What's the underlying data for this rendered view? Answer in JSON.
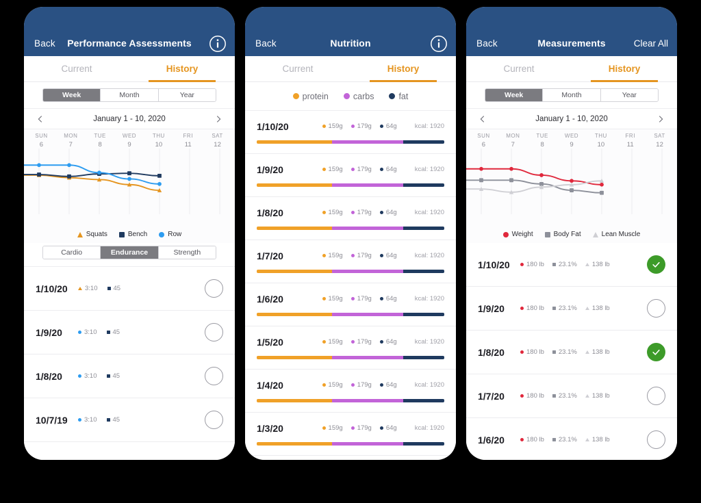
{
  "theme": {
    "nav_bg": "#2a5183",
    "accent_orange": "#e59520",
    "segment_active": "#7b7b80",
    "check_green": "#3d9b29",
    "page_bg": "#000000"
  },
  "shared": {
    "back_label": "Back",
    "tab_current": "Current",
    "tab_history": "History",
    "seg_week": "Week",
    "seg_month": "Month",
    "seg_year": "Year",
    "date_range": "January 1 - 10, 2020",
    "prev_icon": "chevron-left-icon",
    "next_icon": "chevron-right-icon",
    "days": [
      {
        "name": "SUN",
        "num": "6"
      },
      {
        "name": "MON",
        "num": "7"
      },
      {
        "name": "TUE",
        "num": "8"
      },
      {
        "name": "WED",
        "num": "9"
      },
      {
        "name": "THU",
        "num": "10"
      },
      {
        "name": "FRI",
        "num": "11"
      },
      {
        "name": "SAT",
        "num": "12"
      }
    ]
  },
  "panel1": {
    "title": "Performance Assessments",
    "info_icon": "info-circle-icon",
    "chart_data": {
      "type": "line",
      "title": "Performance Assessments",
      "x": [
        "6",
        "7",
        "8",
        "9",
        "10"
      ],
      "xlabel": "",
      "ylabel": "",
      "grid": true,
      "legend_position": "bottom",
      "series": [
        {
          "name": "Squats",
          "color": "#e59520",
          "marker": "triangle",
          "values": [
            62,
            58,
            55,
            47,
            38
          ]
        },
        {
          "name": "Bench",
          "color": "#1f3a5f",
          "marker": "square",
          "values": [
            63,
            60,
            64,
            65,
            61
          ]
        },
        {
          "name": "Row",
          "color": "#2d9cf0",
          "marker": "circle",
          "values": [
            78,
            78,
            66,
            56,
            48
          ]
        }
      ]
    },
    "legend": [
      {
        "label": "Squats",
        "marker": "triangle",
        "color": "#e59520"
      },
      {
        "label": "Bench",
        "marker": "square",
        "color": "#1f3a5f"
      },
      {
        "label": "Row",
        "marker": "circle",
        "color": "#2d9cf0"
      }
    ],
    "filter": {
      "cardio": "Cardio",
      "endurance": "Endurance",
      "strength": "Strength",
      "active": "Endurance"
    },
    "rows": [
      {
        "date": "1/10/20",
        "m1": "3:10",
        "m1_marker": "triangle",
        "m1_color": "#e59520",
        "m2": "45",
        "m2_marker": "square",
        "m2_color": "#1f3a5f",
        "checked": false
      },
      {
        "date": "1/9/20",
        "m1": "3:10",
        "m1_marker": "circle",
        "m1_color": "#2d9cf0",
        "m2": "45",
        "m2_marker": "square",
        "m2_color": "#1f3a5f",
        "checked": false
      },
      {
        "date": "1/8/20",
        "m1": "3:10",
        "m1_marker": "circle",
        "m1_color": "#2d9cf0",
        "m2": "45",
        "m2_marker": "square",
        "m2_color": "#1f3a5f",
        "checked": false
      },
      {
        "date": "10/7/19",
        "m1": "3:10",
        "m1_marker": "circle",
        "m1_color": "#2d9cf0",
        "m2": "45",
        "m2_marker": "square",
        "m2_color": "#1f3a5f",
        "checked": false
      }
    ]
  },
  "panel2": {
    "title": "Nutrition",
    "info_icon": "info-circle-icon",
    "legend": [
      {
        "label": "protein",
        "color": "#f0a128"
      },
      {
        "label": "carbs",
        "color": "#c264d8"
      },
      {
        "label": "fat",
        "color": "#1f3a5f"
      }
    ],
    "chart_data": {
      "type": "bar",
      "title": "Nutrition macros per day",
      "categories": [
        "1/10/20",
        "1/9/20",
        "1/8/20",
        "1/7/20",
        "1/6/20",
        "1/5/20",
        "1/4/20",
        "1/3/20"
      ],
      "series": [
        {
          "name": "protein",
          "color": "#f0a128",
          "unit": "g",
          "values": [
            159,
            159,
            159,
            159,
            159,
            159,
            159,
            159
          ]
        },
        {
          "name": "carbs",
          "color": "#c264d8",
          "unit": "g",
          "values": [
            179,
            179,
            179,
            179,
            179,
            179,
            179,
            179
          ]
        },
        {
          "name": "fat",
          "color": "#1f3a5f",
          "unit": "g",
          "values": [
            64,
            64,
            64,
            64,
            64,
            64,
            64,
            64
          ]
        }
      ],
      "kcal": [
        1920,
        1920,
        1920,
        1920,
        1920,
        1920,
        1920,
        1920
      ],
      "stacked": true
    },
    "rows": [
      {
        "date": "1/10/20",
        "protein": "159g",
        "carbs": "179g",
        "fat": "64g",
        "kcal": "kcal: 1920",
        "p_pct": 40,
        "c_pct": 38,
        "f_pct": 22
      },
      {
        "date": "1/9/20",
        "protein": "159g",
        "carbs": "179g",
        "fat": "64g",
        "kcal": "kcal: 1920",
        "p_pct": 40,
        "c_pct": 38,
        "f_pct": 22
      },
      {
        "date": "1/8/20",
        "protein": "159g",
        "carbs": "179g",
        "fat": "64g",
        "kcal": "kcal: 1920",
        "p_pct": 40,
        "c_pct": 38,
        "f_pct": 22
      },
      {
        "date": "1/7/20",
        "protein": "159g",
        "carbs": "179g",
        "fat": "64g",
        "kcal": "kcal: 1920",
        "p_pct": 40,
        "c_pct": 38,
        "f_pct": 22
      },
      {
        "date": "1/6/20",
        "protein": "159g",
        "carbs": "179g",
        "fat": "64g",
        "kcal": "kcal: 1920",
        "p_pct": 40,
        "c_pct": 38,
        "f_pct": 22
      },
      {
        "date": "1/5/20",
        "protein": "159g",
        "carbs": "179g",
        "fat": "64g",
        "kcal": "kcal: 1920",
        "p_pct": 40,
        "c_pct": 38,
        "f_pct": 22
      },
      {
        "date": "1/4/20",
        "protein": "159g",
        "carbs": "179g",
        "fat": "64g",
        "kcal": "kcal: 1920",
        "p_pct": 40,
        "c_pct": 38,
        "f_pct": 22
      },
      {
        "date": "1/3/20",
        "protein": "159g",
        "carbs": "179g",
        "fat": "64g",
        "kcal": "kcal: 1920",
        "p_pct": 40,
        "c_pct": 38,
        "f_pct": 22
      }
    ]
  },
  "panel3": {
    "title": "Measurements",
    "clear_all_label": "Clear All",
    "chart_data": {
      "type": "line",
      "title": "Measurements",
      "x": [
        "6",
        "7",
        "8",
        "9",
        "10"
      ],
      "xlabel": "",
      "ylabel": "",
      "grid": true,
      "legend_position": "bottom",
      "series": [
        {
          "name": "Weight",
          "color": "#e0283c",
          "marker": "circle",
          "values": [
            72,
            72,
            62,
            53,
            47
          ]
        },
        {
          "name": "Body Fat",
          "color": "#8d909a",
          "marker": "square",
          "values": [
            54,
            54,
            48,
            38,
            34
          ]
        },
        {
          "name": "Lean Muscle",
          "color": "#cfcfd4",
          "marker": "triangle",
          "values": [
            40,
            35,
            43,
            47,
            53
          ]
        }
      ]
    },
    "legend": [
      {
        "label": "Weight",
        "marker": "circle",
        "color": "#e0283c"
      },
      {
        "label": "Body Fat",
        "marker": "square",
        "color": "#8d909a"
      },
      {
        "label": "Lean Muscle",
        "marker": "triangle",
        "color": "#cfcfd4"
      }
    ],
    "rows": [
      {
        "date": "1/10/20",
        "weight": "180 lb",
        "bodyfat": "23.1%",
        "lean": "138 lb",
        "checked": true
      },
      {
        "date": "1/9/20",
        "weight": "180 lb",
        "bodyfat": "23.1%",
        "lean": "138 lb",
        "checked": false
      },
      {
        "date": "1/8/20",
        "weight": "180 lb",
        "bodyfat": "23.1%",
        "lean": "138 lb",
        "checked": true
      },
      {
        "date": "1/7/20",
        "weight": "180 lb",
        "bodyfat": "23.1%",
        "lean": "138 lb",
        "checked": false
      },
      {
        "date": "1/6/20",
        "weight": "180 lb",
        "bodyfat": "23.1%",
        "lean": "138 lb",
        "checked": false
      }
    ]
  }
}
